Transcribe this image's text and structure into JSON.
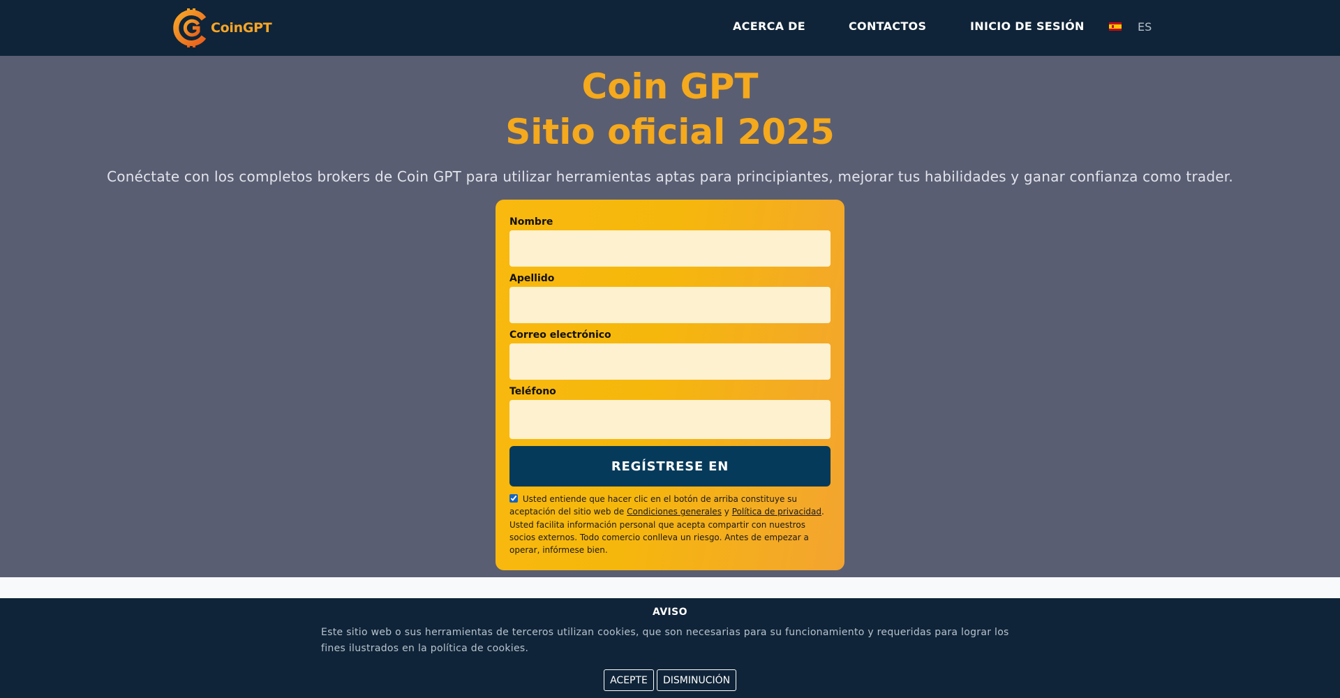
{
  "header": {
    "logo_text": "CoinGPT",
    "nav": {
      "about": "ACERCA DE",
      "contacts": "CONTACTOS",
      "login": "INICIO DE SESIÓN"
    },
    "language": "ES",
    "flag_icon": "spain-flag-icon"
  },
  "hero": {
    "title_line1": "Coin GPT",
    "title_line2": "Sitio oficial 2025",
    "subtitle": "Conéctate con los completos brokers de Coin GPT para utilizar herramientas aptas para principiantes, mejorar tus habilidades y ganar confianza como trader."
  },
  "form": {
    "fields": {
      "first_name": {
        "label": "Nombre",
        "value": "",
        "placeholder": ""
      },
      "last_name": {
        "label": "Apellido",
        "value": "",
        "placeholder": ""
      },
      "email": {
        "label": "Correo electrónico",
        "value": "",
        "placeholder": ""
      },
      "phone": {
        "label": "Teléfono",
        "value": "",
        "placeholder": ""
      }
    },
    "submit_label": "REGÍSTRESE EN",
    "consent": {
      "checked": true,
      "text_before": "Usted entiende que hacer clic en el botón de arriba constituye su aceptación del sitio web de",
      "terms_link": "Condiciones generales",
      "conjunction": "y",
      "privacy_link": "Política de privacidad",
      "text_after": ". Usted facilita información personal que acepta compartir con nuestros socios externos. Todo comercio conlleva un riesgo. Antes de empezar a operar, infórmese bien."
    }
  },
  "cookie_banner": {
    "title": "AVISO",
    "text": "Este sitio web o sus herramientas de terceros utilizan cookies, que son necesarias para su funcionamiento y requeridas para lograr los fines ilustrados en la política de cookies.",
    "accept_label": "ACEPTE",
    "decline_label": "DISMINUCIÓN"
  },
  "colors": {
    "header_bg": "#0f2438",
    "page_bg": "#5a5e72",
    "accent_gold": "#f5a91c",
    "button_bg": "#063a5a",
    "input_bg": "#fdf1cf"
  }
}
